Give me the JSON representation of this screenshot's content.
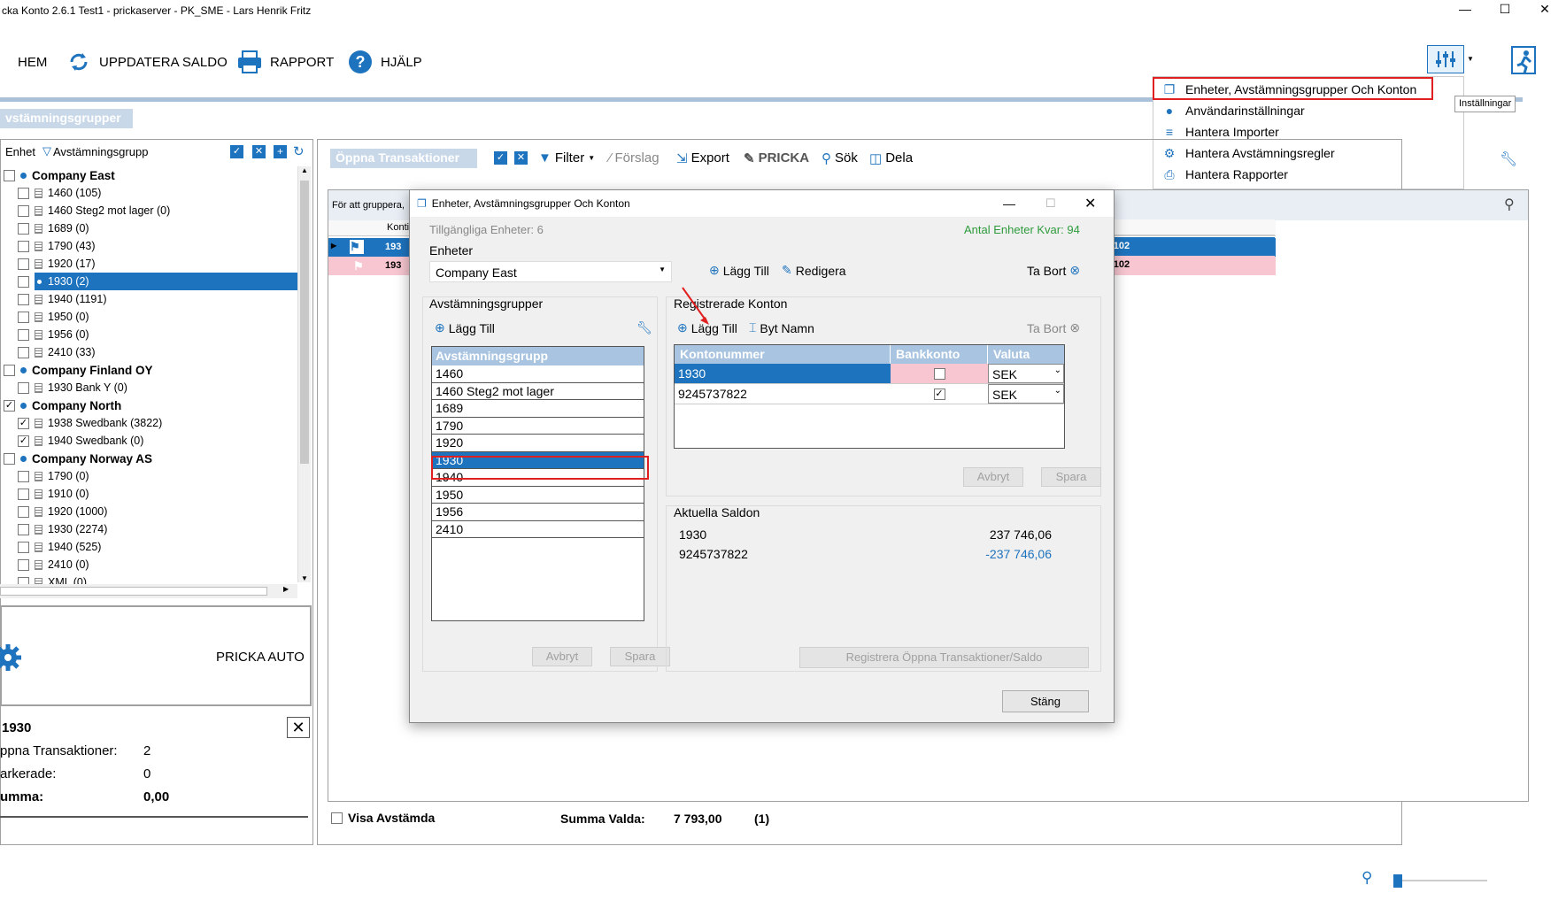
{
  "window": {
    "title": "cka Konto 2.6.1 Test1 - prickaserver - PK_SME - Lars Henrik Fritz",
    "min": "—",
    "max": "☐",
    "close": "✕"
  },
  "toolbar": {
    "home": "HEM",
    "refresh": "UPPDATERA SALDO",
    "report": "RAPPORT",
    "help": "HJÄLP"
  },
  "tooltip": "Inställningar",
  "settings_menu": [
    {
      "label": "Enheter, Avstämningsgrupper Och Konton",
      "icon": "window-icon"
    },
    {
      "label": "Användarinställningar",
      "icon": "user-icon"
    },
    {
      "label": "Hantera Importer",
      "icon": "database-icon"
    },
    {
      "label": "Hantera Avstämningsregler",
      "icon": "gear-icon"
    },
    {
      "label": "Hantera Rapporter",
      "icon": "printer-icon"
    }
  ],
  "left": {
    "section_title": "vstämningsgrupper",
    "col_enhet": "Enhet",
    "col_group": "Avstämningsgrupp",
    "tree": [
      {
        "type": "unit",
        "label": "Company East",
        "checked": ""
      },
      {
        "type": "acct",
        "label": "1460 (105)",
        "checked": ""
      },
      {
        "type": "acct",
        "label": "1460 Steg2 mot lager (0)",
        "checked": ""
      },
      {
        "type": "acct",
        "label": "1689 (0)",
        "checked": ""
      },
      {
        "type": "acct",
        "label": "1790 (43)",
        "checked": ""
      },
      {
        "type": "acct",
        "label": "1920 (17)",
        "checked": ""
      },
      {
        "type": "acct-sel",
        "label": "1930 (2)",
        "checked": ""
      },
      {
        "type": "acct",
        "label": "1940 (1191)",
        "checked": ""
      },
      {
        "type": "acct",
        "label": "1950 (0)",
        "checked": ""
      },
      {
        "type": "acct",
        "label": "1956 (0)",
        "checked": ""
      },
      {
        "type": "acct",
        "label": "2410 (33)",
        "checked": ""
      },
      {
        "type": "unit",
        "label": "Company Finland OY",
        "checked": ""
      },
      {
        "type": "acct",
        "label": "1930 Bank Y (0)",
        "checked": ""
      },
      {
        "type": "unit",
        "label": "Company North",
        "checked": "✓"
      },
      {
        "type": "acct",
        "label": "1938 Swedbank (3822)",
        "checked": "✓"
      },
      {
        "type": "acct",
        "label": "1940 Swedbank (0)",
        "checked": "✓"
      },
      {
        "type": "unit",
        "label": "Company Norway AS",
        "checked": ""
      },
      {
        "type": "acct",
        "label": "1790 (0)",
        "checked": ""
      },
      {
        "type": "acct",
        "label": "1910 (0)",
        "checked": ""
      },
      {
        "type": "acct",
        "label": "1920 (1000)",
        "checked": ""
      },
      {
        "type": "acct",
        "label": "1930 (2274)",
        "checked": ""
      },
      {
        "type": "acct",
        "label": "1940 (525)",
        "checked": ""
      },
      {
        "type": "acct",
        "label": "2410 (0)",
        "checked": ""
      },
      {
        "type": "acct",
        "label": "XML (0)",
        "checked": ""
      }
    ],
    "pricka_auto": "PRICKA AUTO",
    "summary": {
      "title": "1930",
      "open_label": "ppna Transaktioner:",
      "open_value": "2",
      "marked_label": "arkerade:",
      "marked_value": "0",
      "sum_label": "umma:",
      "sum_value": "0,00"
    }
  },
  "main": {
    "section_title": "Öppna Transaktioner",
    "filter": "Filter",
    "forslag": "Förslag",
    "export": "Export",
    "pricka": "PRICKA",
    "sok": "Sök",
    "dela": "Dela",
    "group_hint": "För att gruppera,",
    "col_konto": "Konti",
    "row1_konto": "193",
    "row2_konto": "193",
    "row1_right": ": 102",
    "row2_right": ": 102",
    "col_right": "r",
    "visa_avstamda": "Visa Avstämda",
    "summa_valda_label": "Summa Valda:",
    "summa_valda_value": "7 793,00",
    "summa_valda_count": "(1)"
  },
  "dialog": {
    "title": "Enheter, Avstämningsgrupper Och Konton",
    "available_units": "Tillgängliga Enheter: 6",
    "units_left": "Antal Enheter Kvar: 94",
    "enheter_label": "Enheter",
    "enhet_selected": "Company East",
    "lagg_till": "Lägg Till",
    "redigera": "Redigera",
    "ta_bort": "Ta Bort",
    "groups_label": "Avstämningsgrupper",
    "groups_header": "Avstämningsgrupp",
    "groups": [
      "1460",
      "1460 Steg2 mot lager",
      "1689",
      "1790",
      "1920",
      "1930",
      "1940",
      "1950",
      "1956",
      "2410"
    ],
    "selected_group_index": 5,
    "avbryt": "Avbryt",
    "spara": "Spara",
    "reg_konton_label": "Registrerade Konton",
    "byt_namn": "Byt Namn",
    "konton_headers": [
      "Kontonummer",
      "Bankkonto",
      "Valuta"
    ],
    "konton": [
      {
        "nr": "1930",
        "bank": false,
        "valuta": "SEK"
      },
      {
        "nr": "9245737822",
        "bank": true,
        "valuta": "SEK"
      }
    ],
    "saldon_label": "Aktuella Saldon",
    "saldon": [
      {
        "konto": "1930",
        "value": "237 746,06"
      },
      {
        "konto": "9245737822",
        "value": "-237 746,06"
      }
    ],
    "registrera": "Registrera Öppna Transaktioner/Saldo",
    "stang": "Stäng"
  },
  "colors": {
    "accent": "#1e73be",
    "pink": "#f7c6d0",
    "highlight_red": "#e02020"
  }
}
